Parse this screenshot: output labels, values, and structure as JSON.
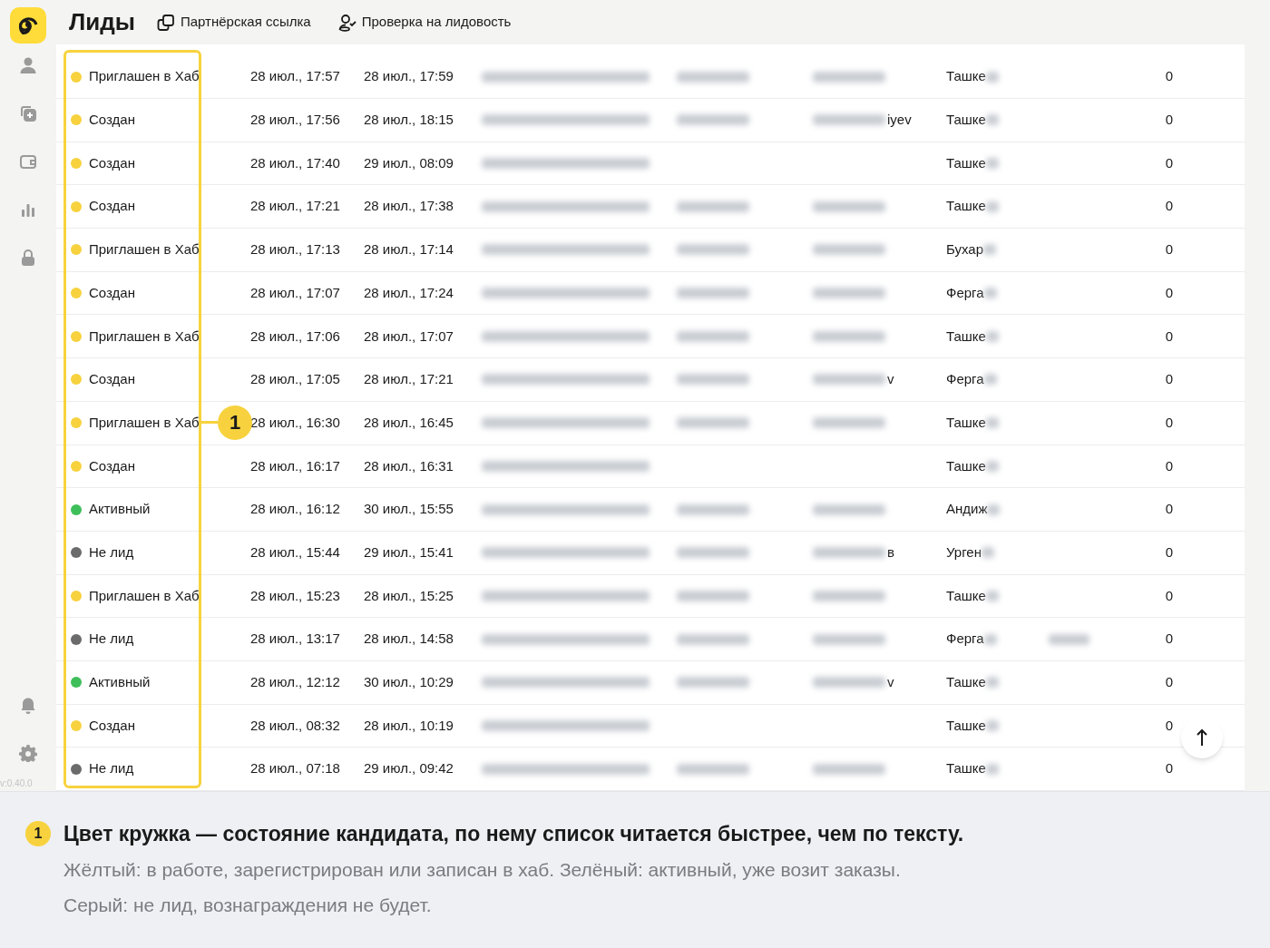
{
  "header": {
    "title": "Лиды",
    "actions": [
      {
        "kind": "link",
        "label": "Партнёрская ссылка"
      },
      {
        "kind": "check",
        "label": "Проверка на лидовость"
      }
    ]
  },
  "sidebar": {
    "version": "v:0.40.0"
  },
  "rows": [
    {
      "status": "Приглашен в Хаб",
      "color": "#f7d23e",
      "created": "28 июл., 17:57",
      "updated": "28 июл., 17:59",
      "email_hidden": true,
      "name_hidden": true,
      "surname_hidden": true,
      "city": "Ташке",
      "count": "0"
    },
    {
      "status": "Создан",
      "color": "#f7d23e",
      "created": "28 июл., 17:56",
      "updated": "28 июл., 18:15",
      "email_hidden": true,
      "name_hidden": true,
      "surname_hidden": true,
      "surname_tail": "iyev",
      "city": "Ташке",
      "count": "0"
    },
    {
      "status": "Создан",
      "color": "#f7d23e",
      "created": "28 июл., 17:40",
      "updated": "29 июл., 08:09",
      "email_hidden": true,
      "name_hidden": false,
      "surname_hidden": false,
      "city": "Ташке",
      "count": "0"
    },
    {
      "status": "Создан",
      "color": "#f7d23e",
      "created": "28 июл., 17:21",
      "updated": "28 июл., 17:38",
      "email_hidden": true,
      "name_hidden": true,
      "surname_hidden": true,
      "city": "Ташке",
      "count": "0"
    },
    {
      "status": "Приглашен в Хаб",
      "color": "#f7d23e",
      "created": "28 июл., 17:13",
      "updated": "28 июл., 17:14",
      "email_hidden": true,
      "name_hidden": true,
      "surname_hidden": true,
      "city": "Бухар",
      "count": "0"
    },
    {
      "status": "Создан",
      "color": "#f7d23e",
      "created": "28 июл., 17:07",
      "updated": "28 июл., 17:24",
      "email_hidden": true,
      "name_hidden": true,
      "surname_hidden": true,
      "city": "Ферга",
      "count": "0"
    },
    {
      "status": "Приглашен в Хаб",
      "color": "#f7d23e",
      "created": "28 июл., 17:06",
      "updated": "28 июл., 17:07",
      "email_hidden": true,
      "name_hidden": true,
      "surname_hidden": true,
      "city": "Ташке",
      "count": "0"
    },
    {
      "status": "Создан",
      "color": "#f7d23e",
      "created": "28 июл., 17:05",
      "updated": "28 июл., 17:21",
      "email_hidden": true,
      "name_hidden": true,
      "surname_hidden": true,
      "surname_tail": "v",
      "city": "Ферга",
      "count": "0"
    },
    {
      "status": "Приглашен в Хаб",
      "color": "#f7d23e",
      "created": "28 июл., 16:30",
      "updated": "28 июл., 16:45",
      "email_hidden": true,
      "name_hidden": true,
      "surname_hidden": true,
      "city": "Ташке",
      "count": "0",
      "callout": "1"
    },
    {
      "status": "Создан",
      "color": "#f7d23e",
      "created": "28 июл., 16:17",
      "updated": "28 июл., 16:31",
      "email_hidden": true,
      "name_hidden": false,
      "surname_hidden": false,
      "city": "Ташке",
      "count": "0"
    },
    {
      "status": "Активный",
      "color": "#3fbf5a",
      "created": "28 июл., 16:12",
      "updated": "30 июл., 15:55",
      "email_hidden": true,
      "name_hidden": true,
      "surname_hidden": true,
      "city": "Андиж",
      "count": "0"
    },
    {
      "status": "Не лид",
      "color": "#6b6b6b",
      "created": "28 июл., 15:44",
      "updated": "29 июл., 15:41",
      "email_hidden": true,
      "name_hidden": true,
      "surname_hidden": true,
      "surname_tail": "в",
      "city": "Урген",
      "count": "0"
    },
    {
      "status": "Приглашен в Хаб",
      "color": "#f7d23e",
      "created": "28 июл., 15:23",
      "updated": "28 июл., 15:25",
      "email_hidden": true,
      "name_hidden": true,
      "surname_hidden": true,
      "city": "Ташке",
      "count": "0"
    },
    {
      "status": "Не лид",
      "color": "#6b6b6b",
      "created": "28 июл., 13:17",
      "updated": "28 июл., 14:58",
      "email_hidden": true,
      "name_hidden": true,
      "surname_hidden": true,
      "city": "Ферга",
      "extra_hidden": true,
      "count": "0"
    },
    {
      "status": "Активный",
      "color": "#3fbf5a",
      "created": "28 июл., 12:12",
      "updated": "30 июл., 10:29",
      "email_hidden": true,
      "name_hidden": true,
      "surname_hidden": true,
      "surname_tail": "v",
      "city": "Ташке",
      "count": "0"
    },
    {
      "status": "Создан",
      "color": "#f7d23e",
      "created": "28 июл., 08:32",
      "updated": "28 июл., 10:19",
      "email_hidden": true,
      "name_hidden": false,
      "surname_hidden": false,
      "city": "Ташке",
      "count": "0"
    },
    {
      "status": "Не лид",
      "color": "#6b6b6b",
      "created": "28 июл., 07:18",
      "updated": "29 июл., 09:42",
      "email_hidden": true,
      "name_hidden": true,
      "surname_hidden": true,
      "city": "Ташке",
      "count": "0"
    }
  ],
  "note": {
    "badge": "1",
    "heading": "Цвет кружка — состояние кандидата, по нему список читается быстрее, чем по тексту.",
    "lines": [
      "Жёлтый: в работе, зарегистрирован или записан в хаб. Зелёный: активный, уже возит заказы.",
      "Серый: не лид, вознаграждения не будет."
    ]
  }
}
